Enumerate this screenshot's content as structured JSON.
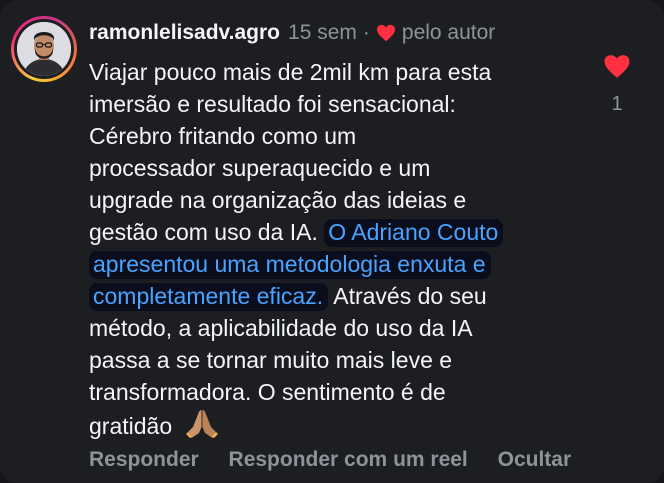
{
  "comment": {
    "username": "ramonlelisadv.agro",
    "time": "15 sem",
    "separator": "·",
    "liked_by": "pelo autor",
    "lines": {
      "l1": "Viajar pouco mais de 2mil km para esta",
      "l2": "imersão e resultado foi sensacional:",
      "l3": "Cérebro fritando como um",
      "l4": "processador superaquecido e um",
      "l5": "upgrade na organização das ideias e",
      "l6_pre": "gestão com uso da IA.",
      "l6_hl": "O Adriano Couto",
      "l7_hl": "apresentou uma metodologia enxuta e",
      "l8_hl": "completamente eficaz.",
      "l8_post": "Através do seu",
      "l9": "método, a aplicabilidade do uso da IA",
      "l10": "passa a se tornar muito mais leve e",
      "l11": "transformadora. O sentimento é de",
      "l12": "gratidão"
    },
    "emoji": "folded-hands-icon",
    "like_count": "1",
    "actions": {
      "reply": "Responder",
      "reply_reel": "Responder com um reel",
      "hide": "Ocultar"
    }
  },
  "colors": {
    "background": "#1d1e22",
    "text": "#f3f5f7",
    "muted": "#8e9399",
    "highlight_text": "#4aa3ff",
    "highlight_bg": "#0a0d1c",
    "heart": "#ff3040"
  }
}
